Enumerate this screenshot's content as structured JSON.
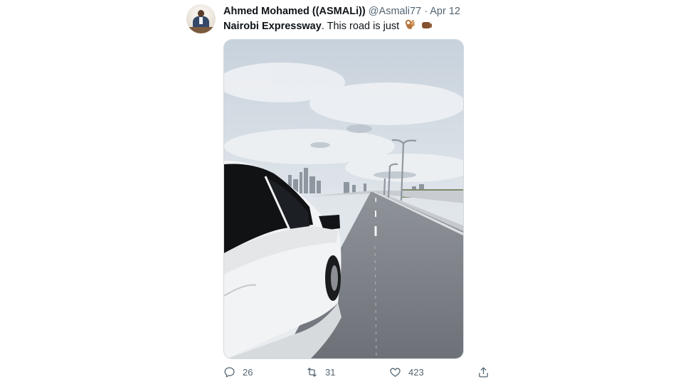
{
  "tweet": {
    "author_name": "Ahmed Mohamed ((ASMALi))",
    "handle": "@Asmali77",
    "separator": "·",
    "date": "Apr 12",
    "text_bold": "Nairobi Expressway",
    "text_rest": ". This road is just",
    "emojis": [
      "ok-hand-emoji",
      "fist-emoji"
    ]
  },
  "actions": {
    "reply_count": "26",
    "retweet_count": "31",
    "like_count": "423"
  },
  "colors": {
    "text": "#0f1419",
    "muted": "#536471"
  }
}
